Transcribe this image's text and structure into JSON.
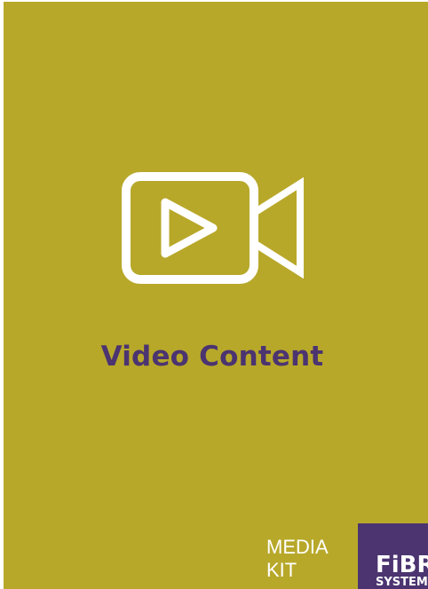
{
  "main": {
    "icon": "video-camera-icon",
    "title": "Video Content"
  },
  "footer": {
    "label_line1": "MEDIA",
    "label_line2": "KIT",
    "logo_main": "FiBR",
    "logo_sub": "SYSTEM"
  },
  "colors": {
    "background": "#b8a82a",
    "accent": "#4b3470",
    "icon": "#ffffff"
  }
}
